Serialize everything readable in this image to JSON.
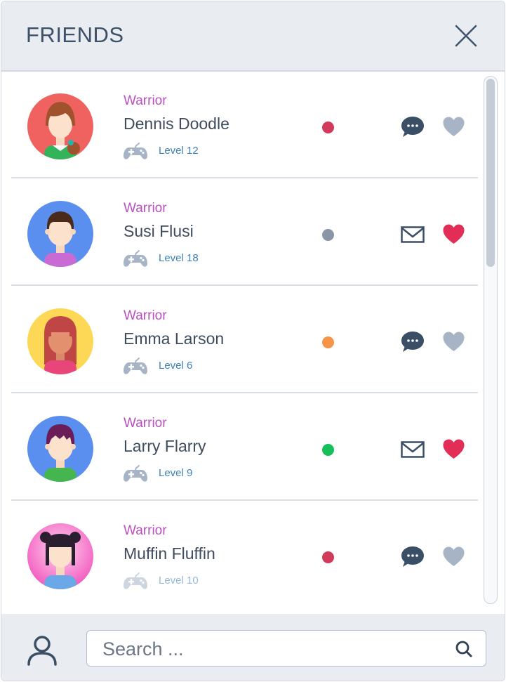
{
  "header": {
    "title": "FRIENDS",
    "close_icon": "close-icon"
  },
  "colors": {
    "class_label": "#b94fc1",
    "name": "#3e4c5e",
    "level": "#3d80b8",
    "status_busy": "#d23a5c",
    "status_offline": "#8a96a8",
    "status_away": "#f5954a",
    "status_online": "#15bf59",
    "heart_active": "#e22e57",
    "heart_inactive": "#a6b4c6",
    "icon_dark": "#3a4e66"
  },
  "friends": [
    {
      "class": "Warrior",
      "name": "Dennis Doodle",
      "level": "Level 12",
      "status": "busy",
      "message_icon": "chat-bubble-icon",
      "favorite": false
    },
    {
      "class": "Warrior",
      "name": "Susi Flusi",
      "level": "Level 18",
      "status": "offline",
      "message_icon": "envelope-icon",
      "favorite": true
    },
    {
      "class": "Warrior",
      "name": "Emma Larson",
      "level": "Level 6",
      "status": "away",
      "message_icon": "chat-bubble-icon",
      "favorite": false
    },
    {
      "class": "Warrior",
      "name": "Larry Flarry",
      "level": "Level 9",
      "status": "online",
      "message_icon": "envelope-icon",
      "favorite": true
    },
    {
      "class": "Warrior",
      "name": "Muffin Fluffin",
      "level": "Level 10",
      "status": "busy",
      "message_icon": "chat-bubble-icon",
      "favorite": false
    }
  ],
  "footer": {
    "profile_icon": "user-icon",
    "search": {
      "placeholder": "Search ...",
      "value": "",
      "icon": "search-icon"
    }
  }
}
